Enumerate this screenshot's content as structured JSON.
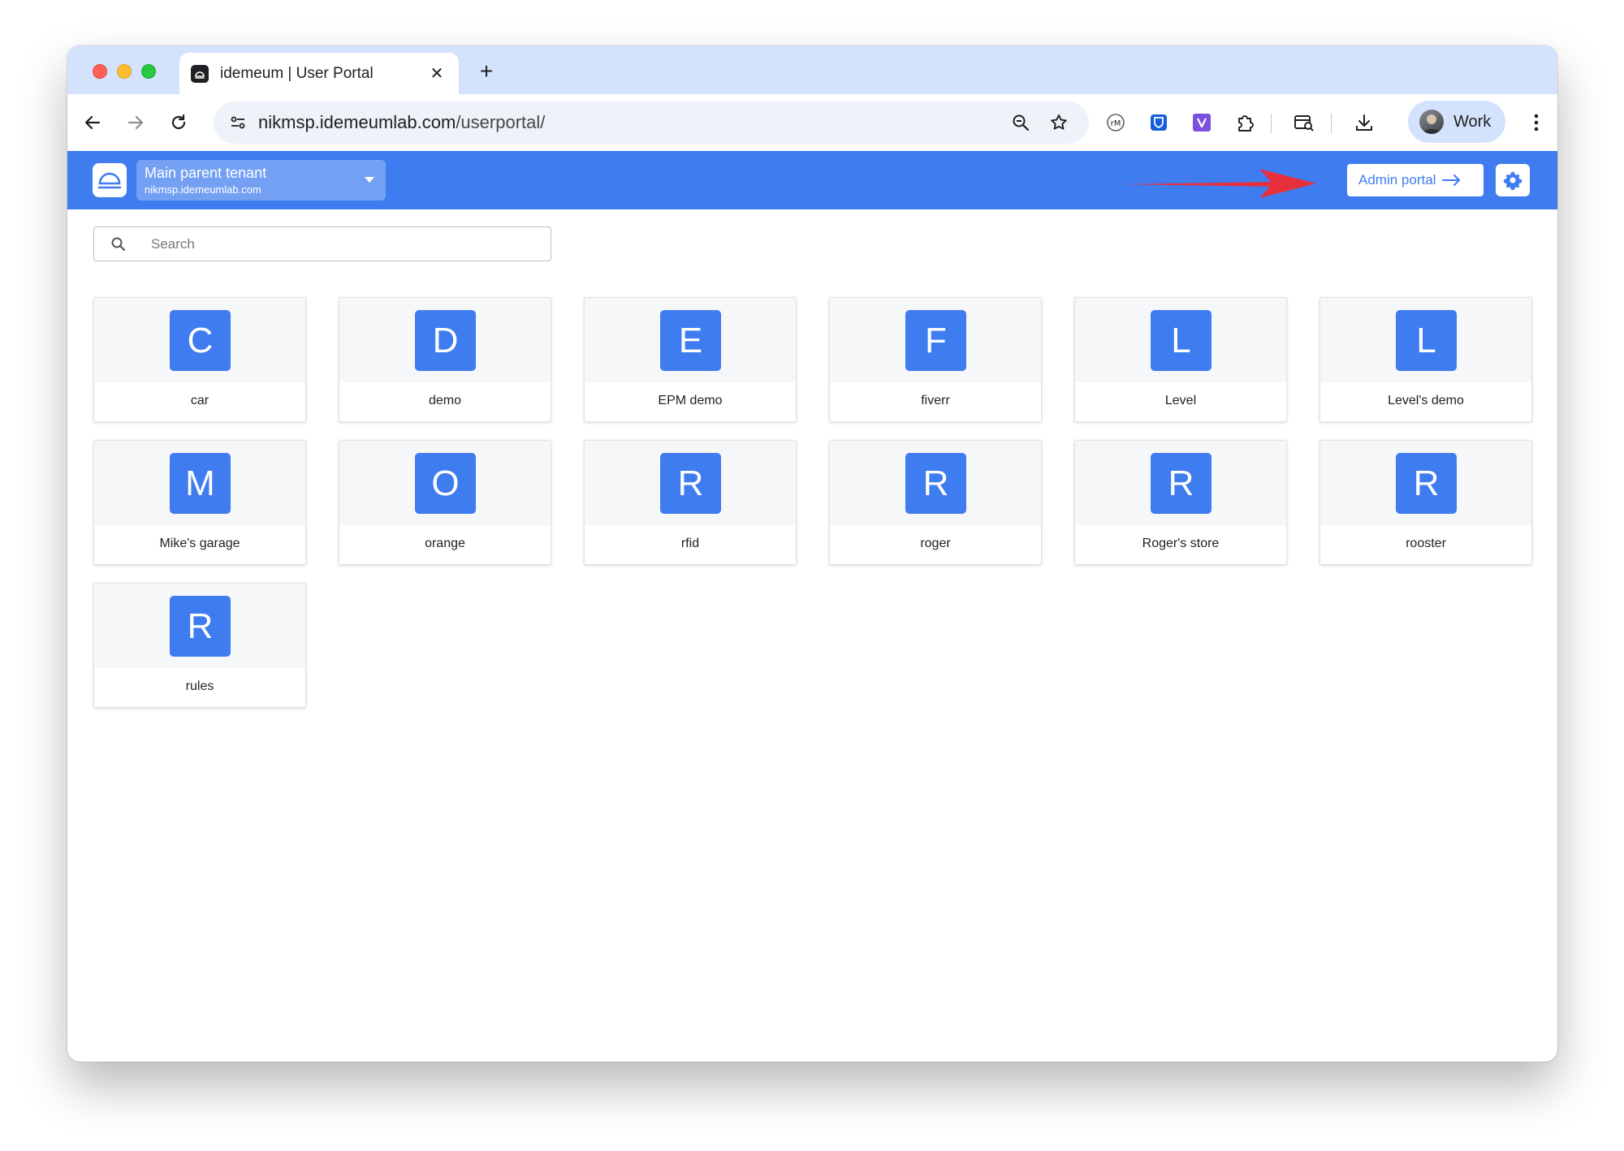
{
  "browser": {
    "tab_title": "idemeum | User Portal",
    "tab_close": "✕",
    "new_tab": "+",
    "url_host": "nikmsp.idemeumlab.com",
    "url_path": "/userportal/",
    "profile_name": "Work"
  },
  "header": {
    "tenant_name": "Main parent tenant",
    "tenant_domain": "nikmsp.idemeumlab.com",
    "admin_portal_label": "Admin portal",
    "accent_color": "#3f7cf0",
    "annotation_color": "#e8303d"
  },
  "search": {
    "placeholder": "Search"
  },
  "apps": [
    {
      "letter": "C",
      "name": "car"
    },
    {
      "letter": "D",
      "name": "demo"
    },
    {
      "letter": "E",
      "name": "EPM demo"
    },
    {
      "letter": "F",
      "name": "fiverr"
    },
    {
      "letter": "L",
      "name": "Level"
    },
    {
      "letter": "L",
      "name": "Level's demo"
    },
    {
      "letter": "M",
      "name": "Mike's garage"
    },
    {
      "letter": "O",
      "name": "orange"
    },
    {
      "letter": "R",
      "name": "rfid"
    },
    {
      "letter": "R",
      "name": "roger"
    },
    {
      "letter": "R",
      "name": "Roger's store"
    },
    {
      "letter": "R",
      "name": "rooster"
    },
    {
      "letter": "R",
      "name": "rules"
    }
  ]
}
